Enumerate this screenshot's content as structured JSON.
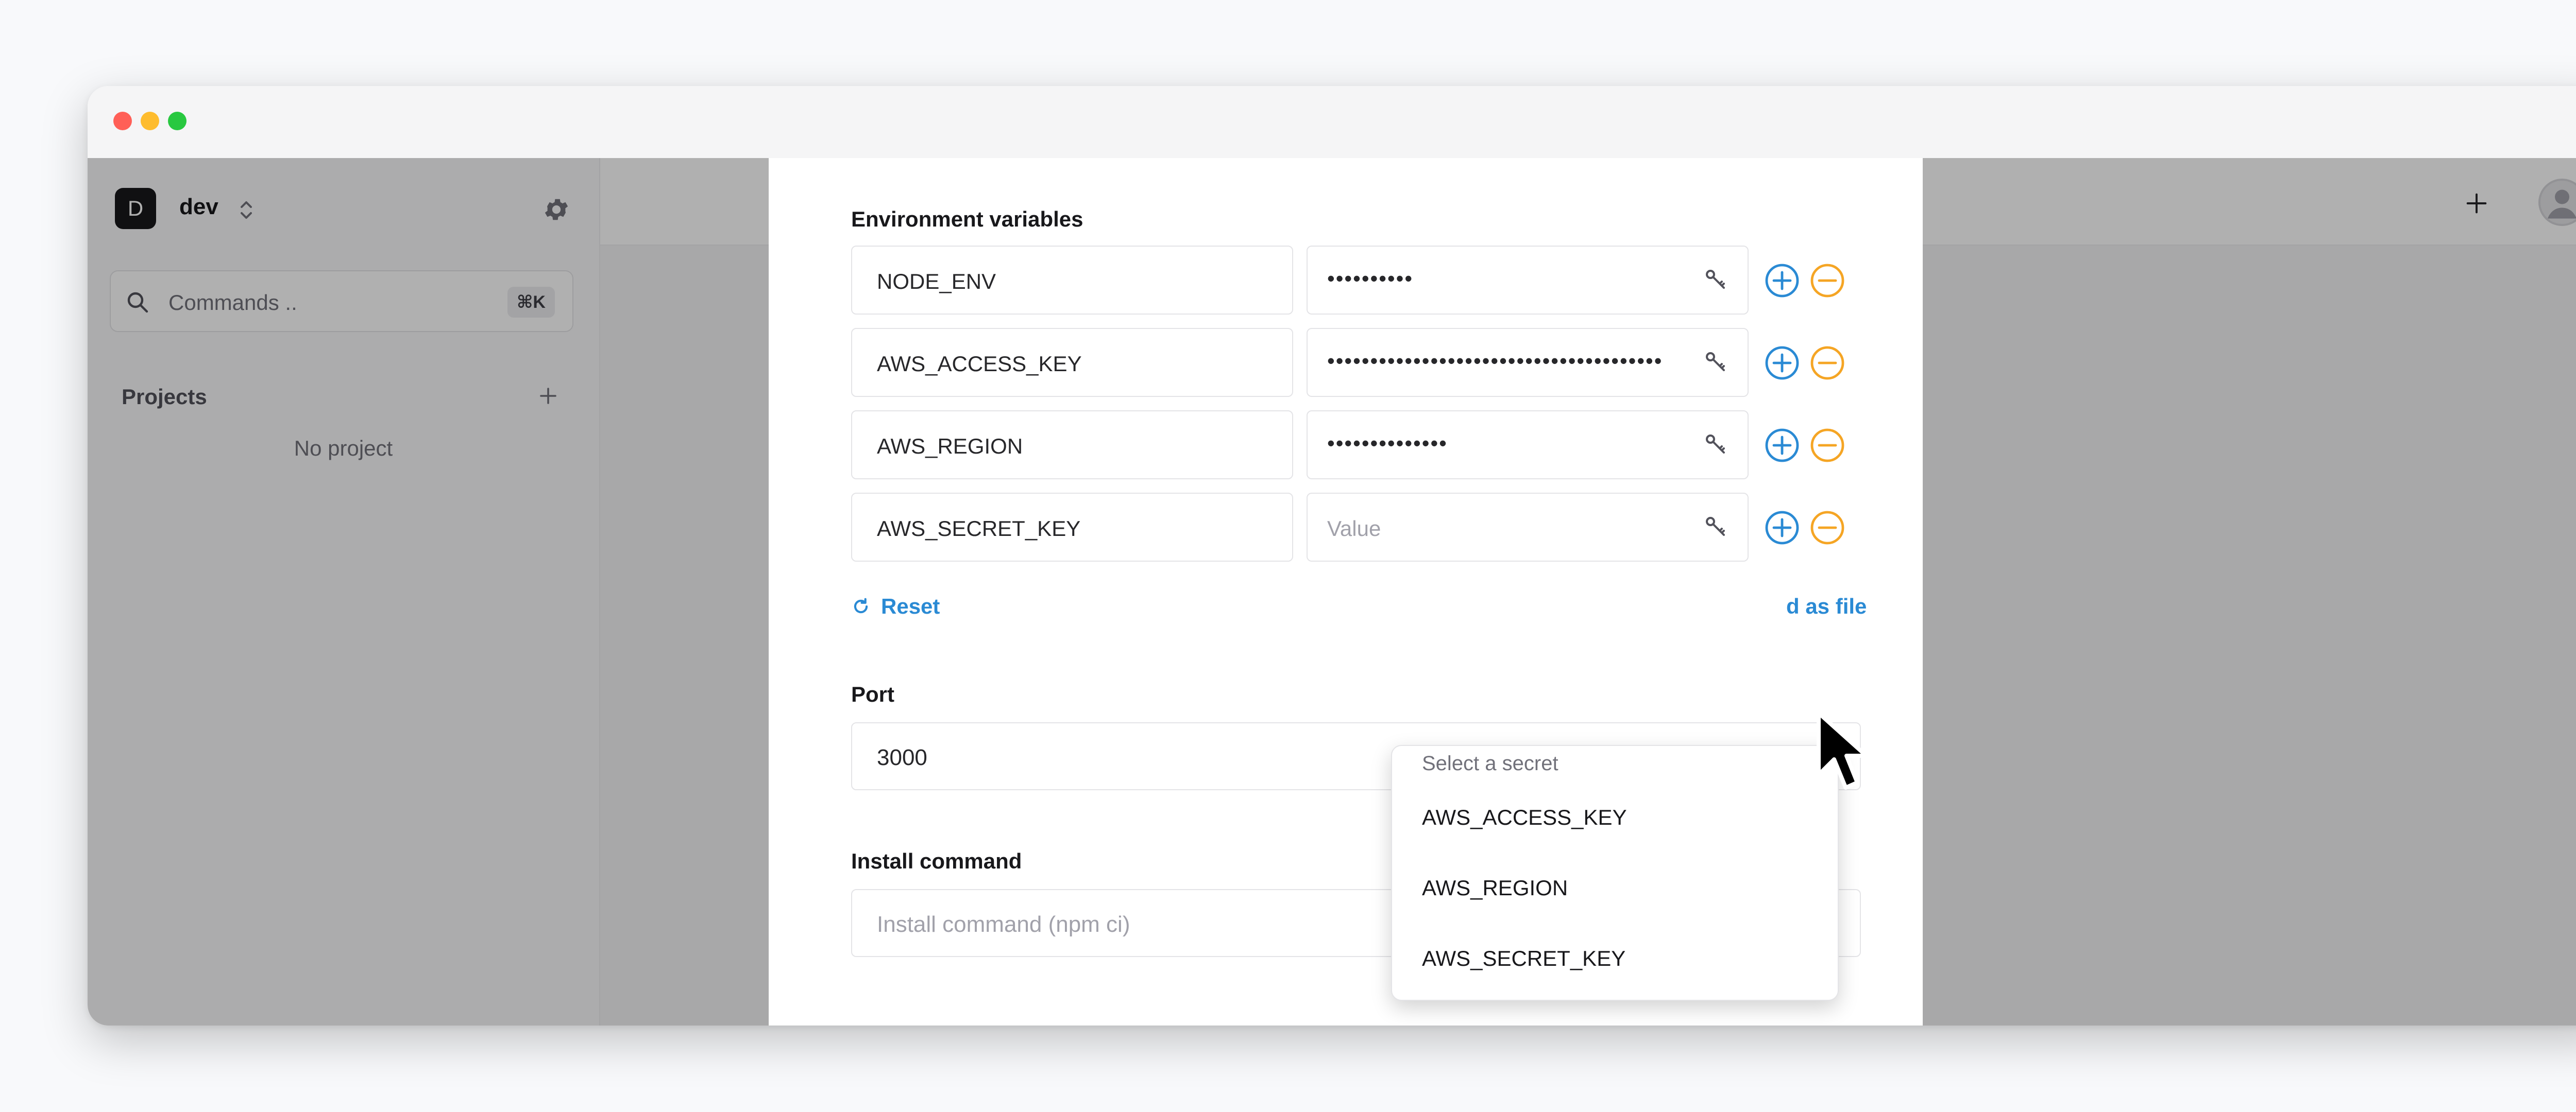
{
  "sidebar": {
    "workspace_initial": "D",
    "workspace_name": "dev",
    "search_placeholder": "Commands ..",
    "search_shortcut": "⌘K",
    "projects_label": "Projects",
    "empty_projects": "No project"
  },
  "panel": {
    "env_section_label": "Environment variables",
    "env_rows": [
      {
        "key": "NODE_ENV",
        "value_mask": "••••••••••",
        "value_placeholder": ""
      },
      {
        "key": "AWS_ACCESS_KEY",
        "value_mask": "•••••••••••••••••••••••••••••••••••••••",
        "value_placeholder": ""
      },
      {
        "key": "AWS_REGION",
        "value_mask": "••••••••••••••",
        "value_placeholder": ""
      },
      {
        "key": "AWS_SECRET_KEY",
        "value_mask": "",
        "value_placeholder": "Value"
      }
    ],
    "reset_label": "Reset",
    "add_as_file_label": "d as file",
    "port_label": "Port",
    "port_value": "3000",
    "install_label": "Install command",
    "install_placeholder": "Install command (npm ci)"
  },
  "secret_dropdown": {
    "title": "Select a secret",
    "options": [
      "AWS_ACCESS_KEY",
      "AWS_REGION",
      "AWS_SECRET_KEY"
    ]
  },
  "colors": {
    "accent_blue": "#2a8ad4",
    "minus_orange": "#f5a524",
    "overlay": "#000000"
  }
}
